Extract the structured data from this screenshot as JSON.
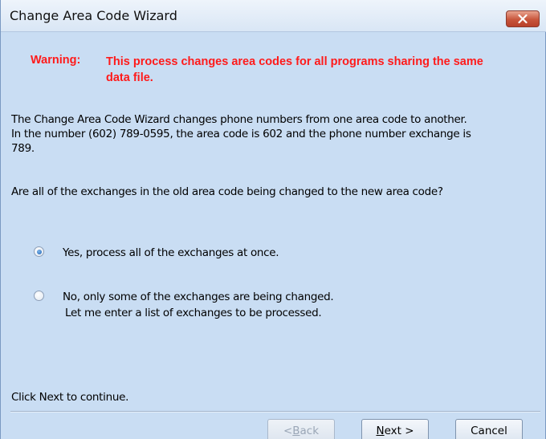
{
  "window": {
    "title": "Change Area Code Wizard"
  },
  "warning": {
    "label": "Warning:",
    "text": "This process changes area codes for all programs sharing the same data file."
  },
  "description": {
    "line1": "The Change Area Code Wizard changes phone numbers from one area code to another.",
    "line2": "In the number (602) 789-0595, the area code is 602 and the phone number exchange is",
    "line3": "789."
  },
  "question": "Are all of the exchanges in the old area code being changed to the new area code?",
  "options": [
    {
      "line1": "Yes, process all of the exchanges at once.",
      "line2": "",
      "selected": true
    },
    {
      "line1": "No, only some of the exchanges are being changed.",
      "line2": "Let me enter a list of exchanges to be processed.",
      "selected": false
    }
  ],
  "footer_text": "Click Next to continue.",
  "buttons": {
    "back": {
      "mnemonic": "B",
      "rest": "ack",
      "prefix": "< ",
      "enabled": false
    },
    "next": {
      "mnemonic": "N",
      "rest": "ext >",
      "prefix": "",
      "enabled": true
    },
    "cancel": {
      "label": "Cancel",
      "enabled": true
    }
  },
  "colors": {
    "background": "#c9ddf3",
    "warning": "#ff1a1a",
    "close_button": "#c8553b",
    "radio_selected": "#1c5fb0"
  },
  "icons": {
    "close": "close-x-icon"
  }
}
